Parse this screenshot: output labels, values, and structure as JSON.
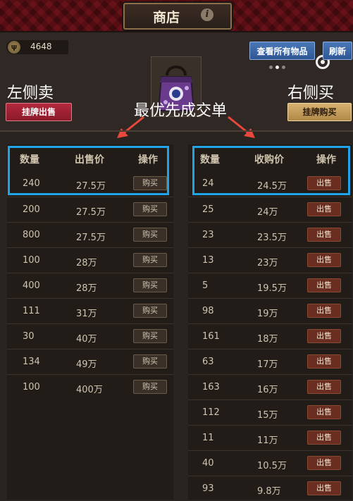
{
  "header": {
    "title": "商店",
    "info_icon": "info-icon"
  },
  "currency": {
    "icon": "coin-icon",
    "amount": "4648"
  },
  "toolbar": {
    "view_all_label": "查看所有物品",
    "refresh_label": "刷新"
  },
  "annotations": {
    "left_text": "左侧卖",
    "right_text": "右侧买",
    "center_text": "最优先成交单",
    "highlight_color": "#20a4e8",
    "arrow_color": "#e8473c"
  },
  "actions": {
    "list_sell_label": "挂牌出售",
    "list_buy_label": "挂牌购买"
  },
  "sell_table": {
    "headers": [
      "数量",
      "出售价",
      "操作"
    ],
    "rows": [
      {
        "qty": "240",
        "price": "27.5万",
        "action": "购买"
      },
      {
        "qty": "200",
        "price": "27.5万",
        "action": "购买"
      },
      {
        "qty": "800",
        "price": "27.5万",
        "action": "购买"
      },
      {
        "qty": "100",
        "price": "28万",
        "action": "购买"
      },
      {
        "qty": "400",
        "price": "28万",
        "action": "购买"
      },
      {
        "qty": "111",
        "price": "31万",
        "action": "购买"
      },
      {
        "qty": "30",
        "price": "40万",
        "action": "购买"
      },
      {
        "qty": "134",
        "price": "49万",
        "action": "购买"
      },
      {
        "qty": "100",
        "price": "400万",
        "action": "购买"
      }
    ]
  },
  "buy_table": {
    "headers": [
      "数量",
      "收购价",
      "操作"
    ],
    "rows": [
      {
        "qty": "24",
        "price": "24.5万",
        "action": "出售"
      },
      {
        "qty": "25",
        "price": "24万",
        "action": "出售"
      },
      {
        "qty": "23",
        "price": "23.5万",
        "action": "出售"
      },
      {
        "qty": "13",
        "price": "23万",
        "action": "出售"
      },
      {
        "qty": "5",
        "price": "19.5万",
        "action": "出售"
      },
      {
        "qty": "98",
        "price": "19万",
        "action": "出售"
      },
      {
        "qty": "161",
        "price": "18万",
        "action": "出售"
      },
      {
        "qty": "63",
        "price": "17万",
        "action": "出售"
      },
      {
        "qty": "163",
        "price": "16万",
        "action": "出售"
      },
      {
        "qty": "112",
        "price": "15万",
        "action": "出售"
      },
      {
        "qty": "11",
        "price": "11万",
        "action": "出售"
      },
      {
        "qty": "40",
        "price": "10.5万",
        "action": "出售"
      },
      {
        "qty": "93",
        "price": "9.8万",
        "action": "出售"
      }
    ]
  }
}
